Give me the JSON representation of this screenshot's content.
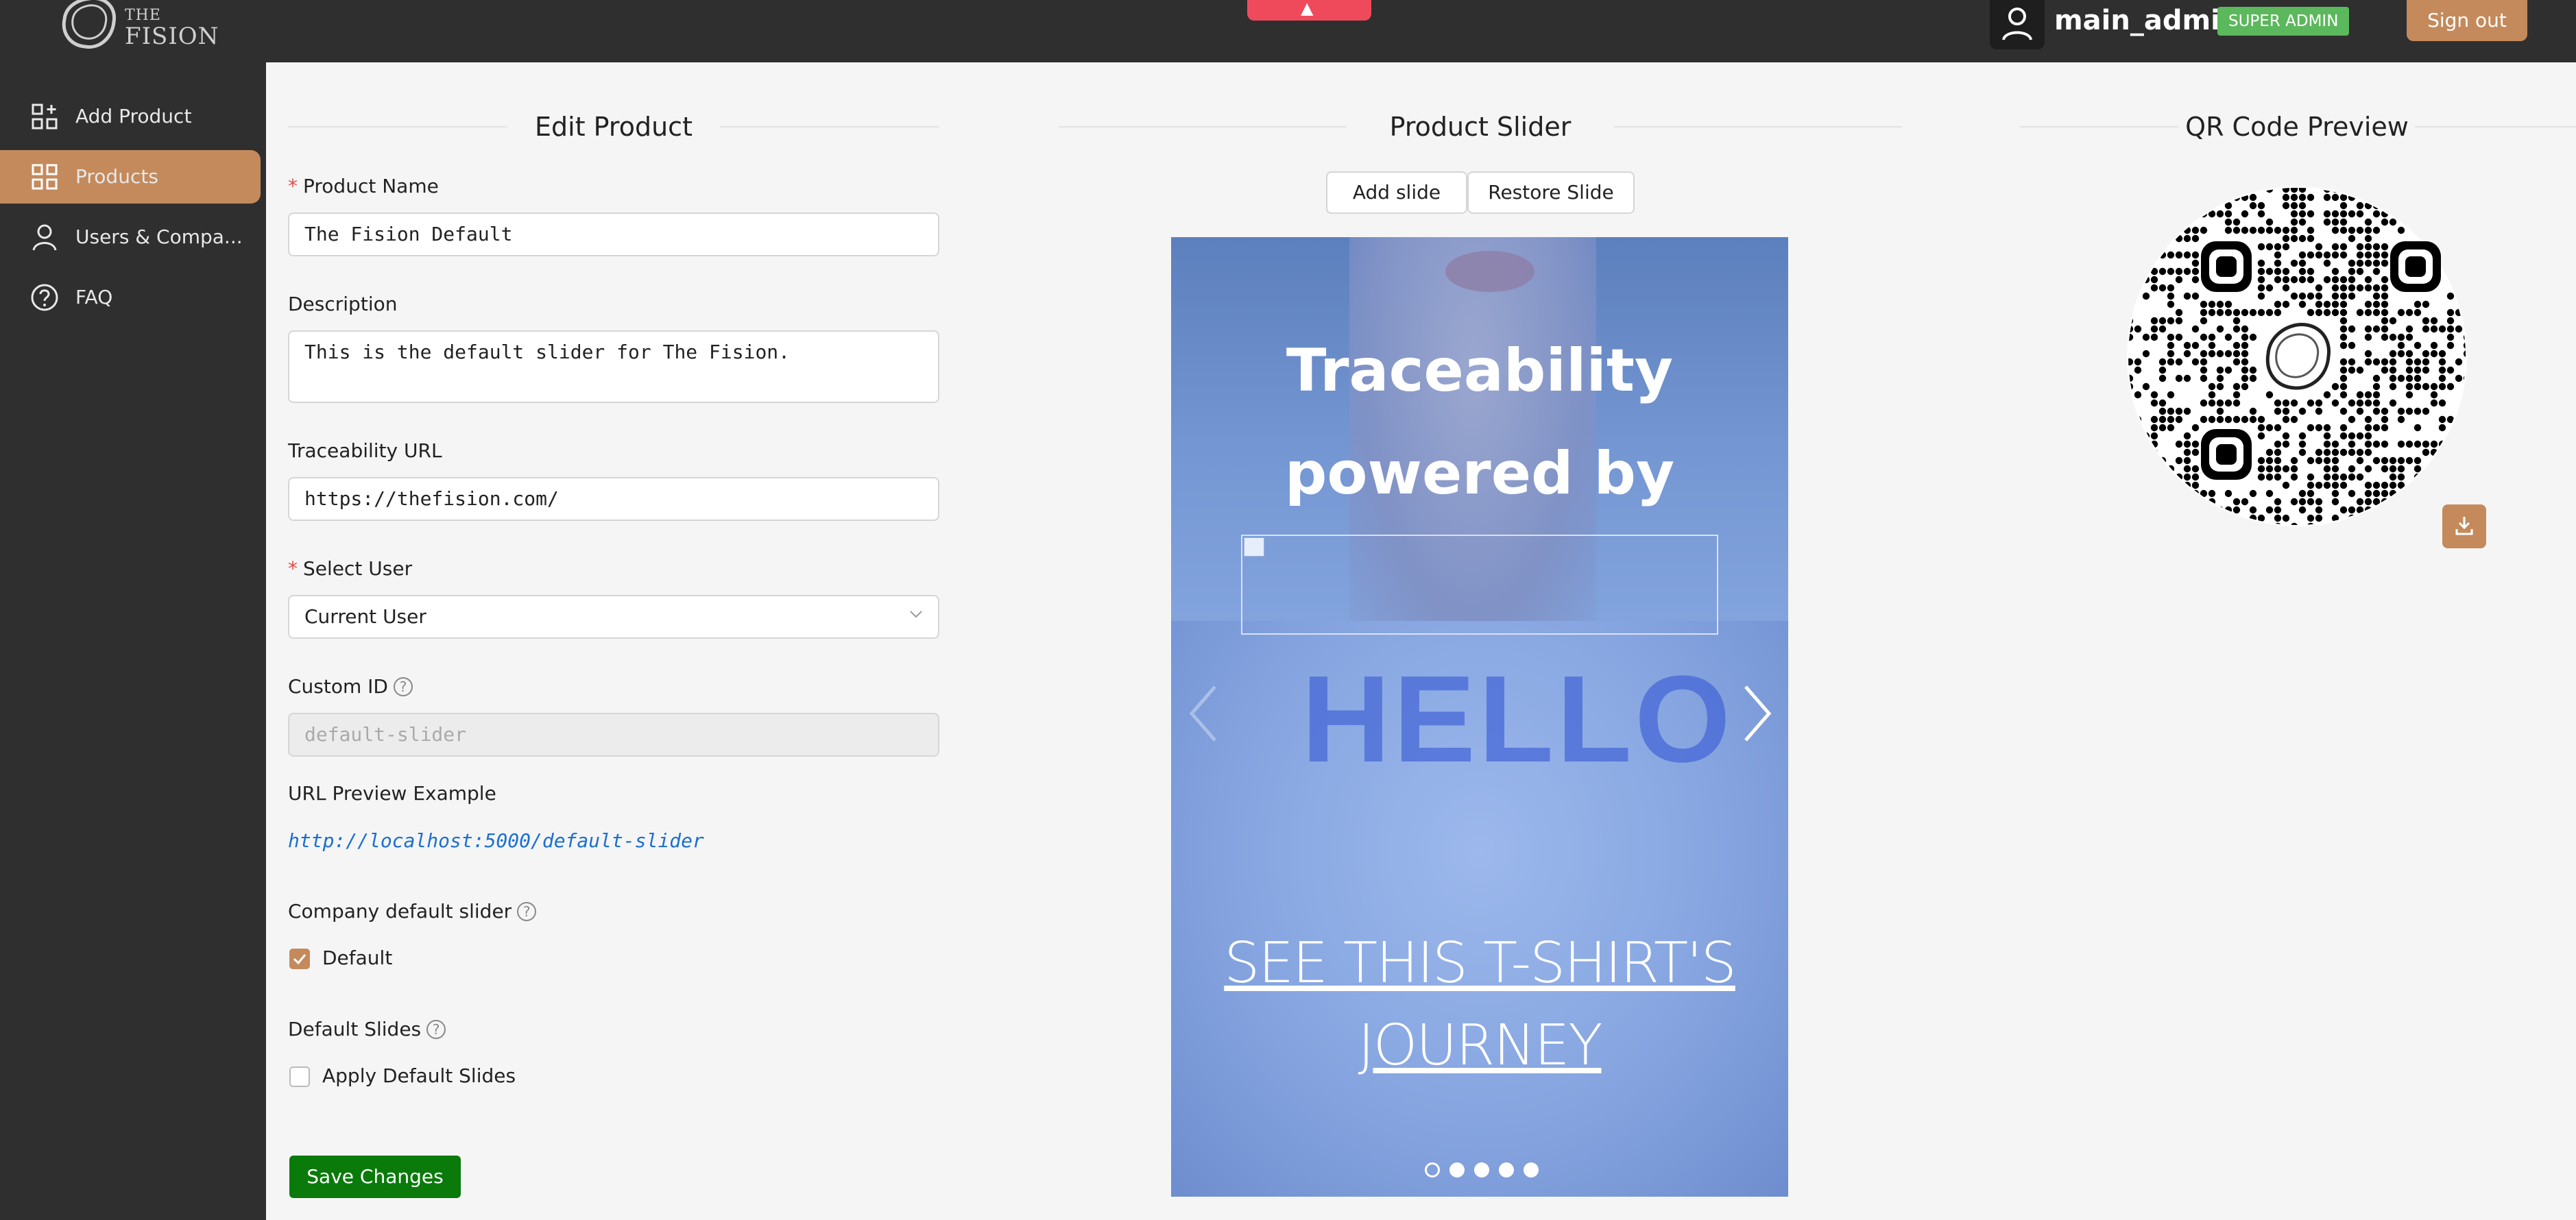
{
  "brand": {
    "logo_text": "FISION",
    "logo_small": "THE"
  },
  "header": {
    "username": "main_admin",
    "role": "SUPER ADMIN",
    "signout": "Sign out"
  },
  "sidebar": {
    "items": [
      {
        "label": "Add Product",
        "icon": "add-grid-icon"
      },
      {
        "label": "Products",
        "icon": "grid-icon",
        "active": true
      },
      {
        "label": "Users & Compa...",
        "icon": "user-icon"
      },
      {
        "label": "FAQ",
        "icon": "question-icon"
      }
    ]
  },
  "edit_product": {
    "title": "Edit Product",
    "product_name_label": "Product Name",
    "product_name_value": "The Fision Default",
    "description_label": "Description",
    "description_value": "This is the default slider for The Fision.",
    "traceability_label": "Traceability URL",
    "traceability_value": "https://thefision.com/",
    "select_user_label": "Select User",
    "select_user_value": "Current User",
    "custom_id_label": "Custom ID",
    "custom_id_placeholder": "default-slider",
    "url_preview_label": "URL Preview Example",
    "url_preview_value": "http://localhost:5000/default-slider",
    "company_default_label": "Company default slider",
    "default_checkbox_label": "Default",
    "default_checked": true,
    "default_slides_label": "Default Slides",
    "apply_default_label": "Apply Default Slides",
    "apply_default_checked": false,
    "save_label": "Save Changes"
  },
  "product_slider": {
    "title": "Product Slider",
    "add_slide": "Add slide",
    "restore_slide": "Restore Slide",
    "headline_line1": "Traceability",
    "headline_line2": "powered by",
    "shirt_text": "HELLO",
    "cta_line1": "SEE THIS T-SHIRT'S",
    "cta_line2": "JOURNEY",
    "dots_count": 5,
    "active_dot": 0
  },
  "qr_preview": {
    "title": "QR Code Preview"
  },
  "colors": {
    "accent": "#c48a5c",
    "dark": "#2f2f2f",
    "success": "#0a7a0a",
    "badge": "#5cb85c",
    "link": "#1a6fd1",
    "alert": "#ef4a5c"
  }
}
